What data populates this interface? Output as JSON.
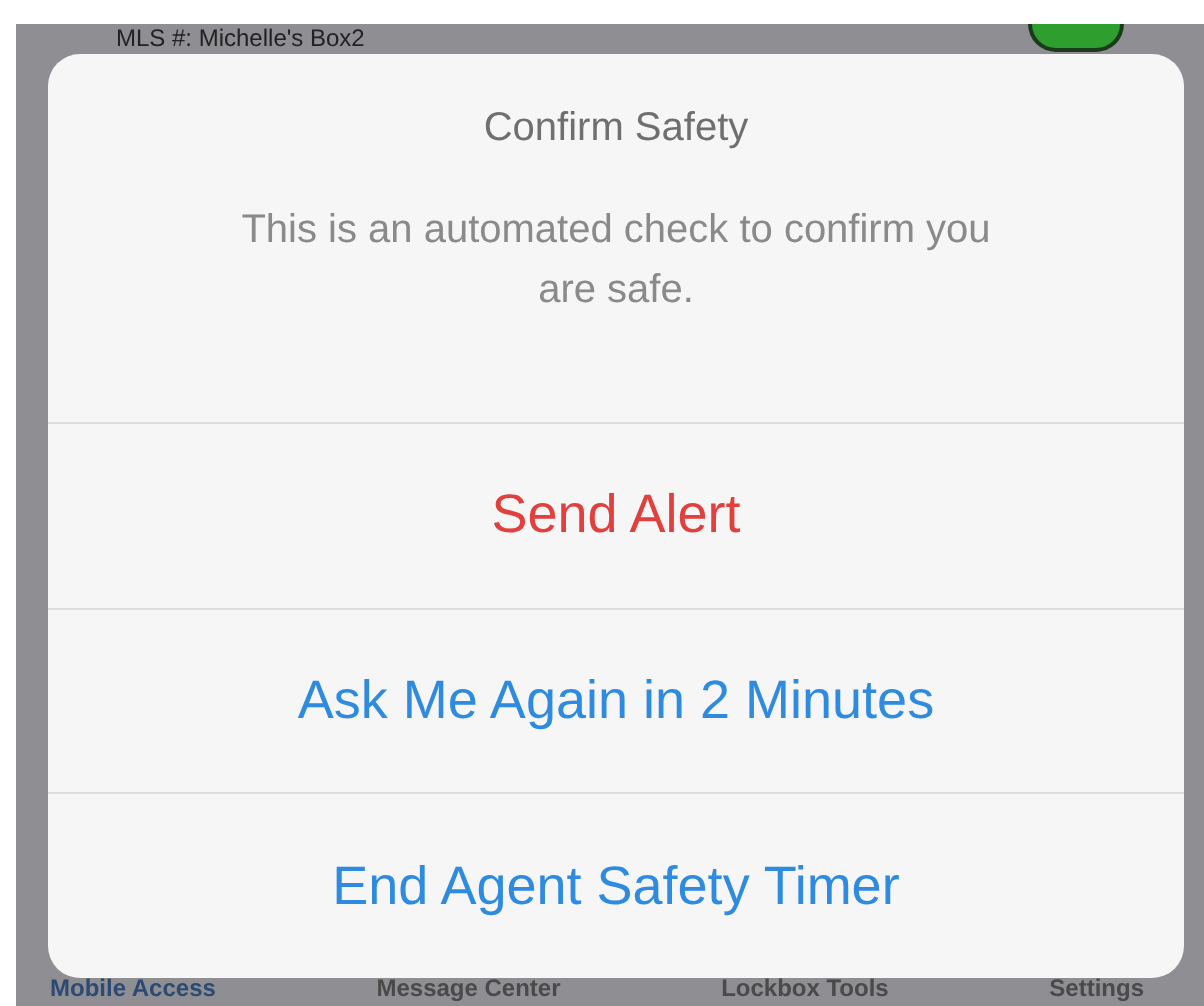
{
  "background": {
    "row_title": "MLS #: Michelle's Box2",
    "toggle_on": true
  },
  "alert": {
    "title": "Confirm Safety",
    "message": "This is an automated check to confirm you are safe.",
    "actions": [
      {
        "label": "Send Alert",
        "kind": "destructive"
      },
      {
        "label": "Ask Me Again in 2 Minutes",
        "kind": "default"
      },
      {
        "label": "End Agent Safety Timer",
        "kind": "default"
      }
    ]
  },
  "tab_bar": [
    {
      "label": "Mobile Access",
      "selected": true
    },
    {
      "label": "Message Center",
      "selected": false
    },
    {
      "label": "Lockbox Tools",
      "selected": false
    },
    {
      "label": "Settings",
      "selected": false
    }
  ]
}
